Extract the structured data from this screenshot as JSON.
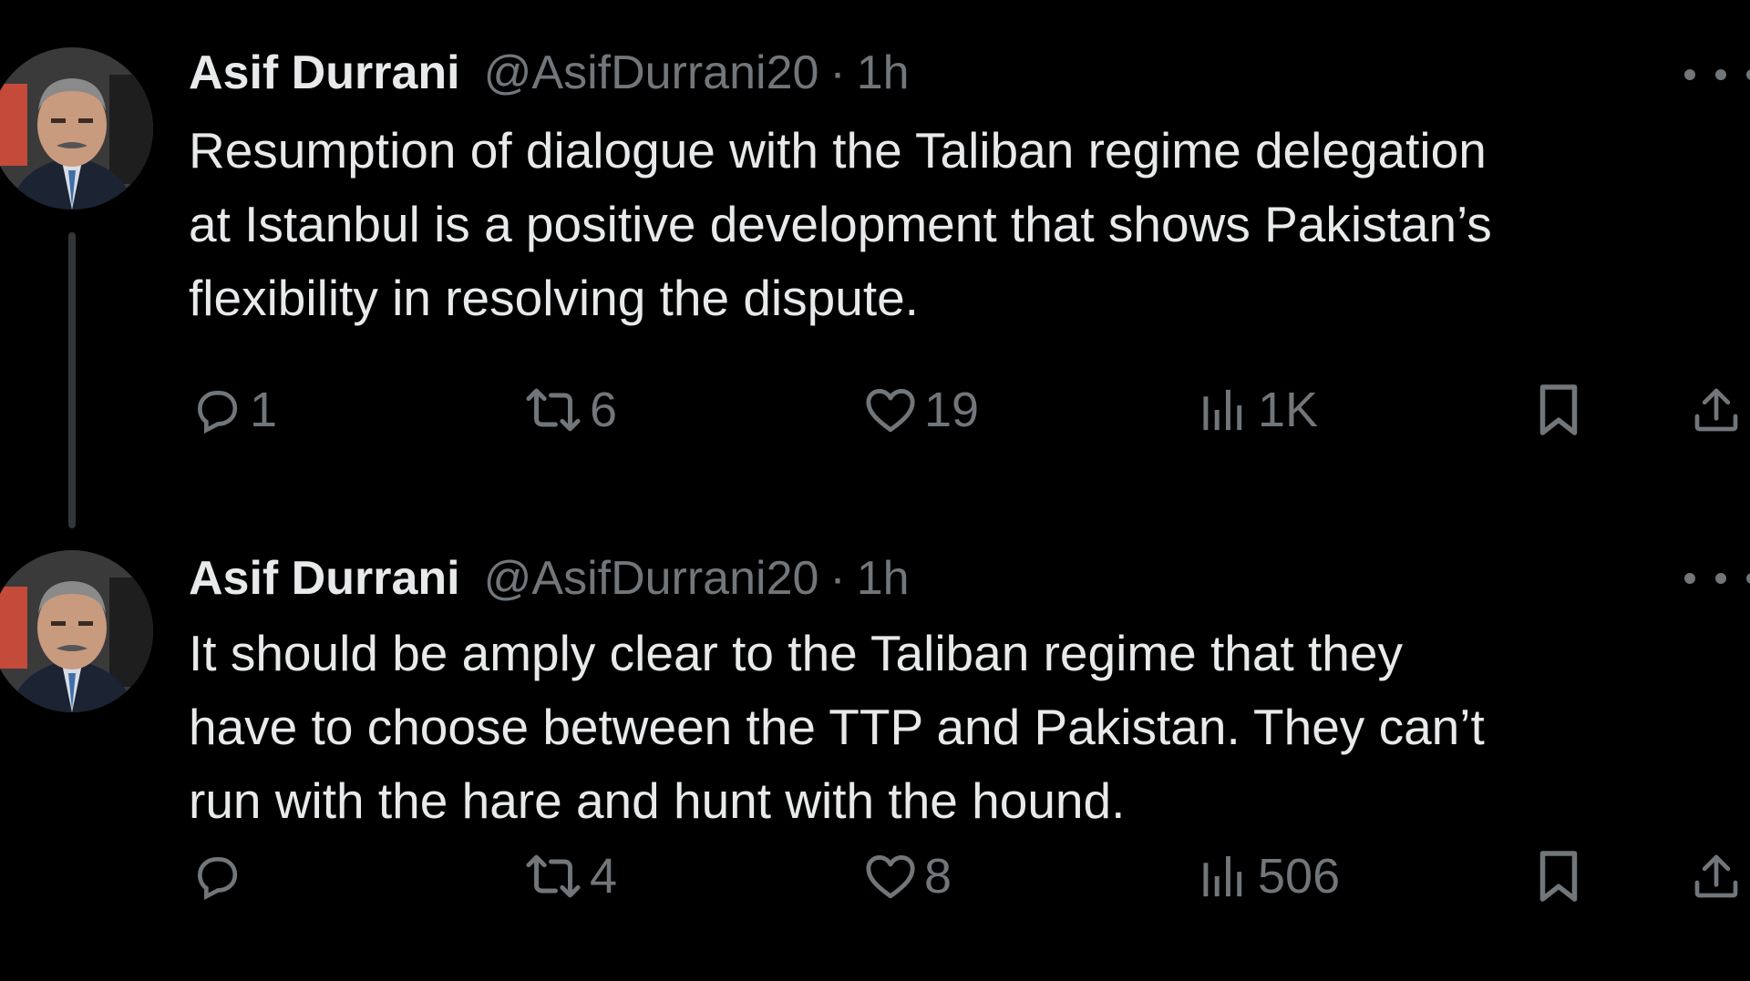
{
  "tweets": [
    {
      "name": "Asif Durrani",
      "handle": "@AsifDurrani20",
      "separator": "·",
      "time": "1h",
      "text": "Resumption of dialogue with the Taliban regime delegation\nat Istanbul is a positive development that shows Pakistan’s\nflexibility in resolving the dispute.",
      "replies": "1",
      "retweets": "6",
      "likes": "19",
      "views": "1K"
    },
    {
      "name": "Asif Durrani",
      "handle": "@AsifDurrani20",
      "separator": "·",
      "time": "1h",
      "text": "It should be amply clear to the Taliban regime that they\nhave to choose between the TTP and Pakistan. They can’t\nrun with the hare and hunt with the hound.",
      "replies": "",
      "retweets": "4",
      "likes": "8",
      "views": "506"
    }
  ],
  "icons": {
    "reply": "reply-icon",
    "retweet": "retweet-icon",
    "like": "heart-icon",
    "views": "views-chart-icon",
    "bookmark": "bookmark-icon",
    "share": "share-icon",
    "more": "more-dots-icon"
  },
  "colors": {
    "background": "#000000",
    "text_primary": "#e7e9ea",
    "text_secondary": "#71767b",
    "thread_line": "#333639"
  }
}
